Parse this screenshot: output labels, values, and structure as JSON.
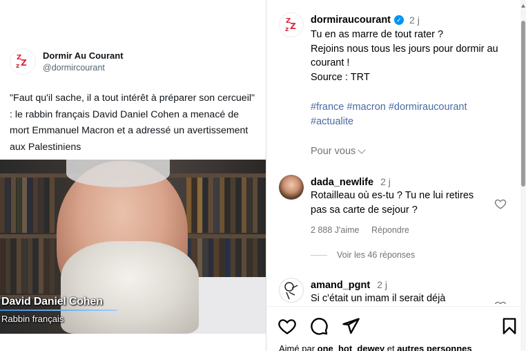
{
  "tweet": {
    "display_name": "Dormir Au Courant",
    "handle": "@dormircourant",
    "text": "\"Faut qu'il sache, il a tout intérêt à préparer son cercueil\" : le rabbin français David Daniel Cohen a menacé de mort Emmanuel Macron et a adressé un avertissement aux Palestiniens",
    "video_caption_name": "David Daniel Cohen",
    "video_caption_title": "Rabbin français",
    "avatar_glyph": "zzz-logo-icon"
  },
  "post": {
    "username": "dormiraucourant",
    "verified": true,
    "time": "2 j",
    "caption_lines": [
      "Tu en as marre de tout rater ?",
      "Rejoins nous tous les jours pour dormir au courant !",
      "Source : TRT"
    ],
    "hashtags": [
      "#france",
      "#macron",
      "#dormiraucourant",
      "#actualite"
    ],
    "for_you_label": "Pour vous"
  },
  "comments": [
    {
      "username": "dada_newlife",
      "time": "2 j",
      "text": "Rotailleau où es-tu ? Tu ne lui retires pas sa carte de sejour ?",
      "likes_label": "2 888 J'aime",
      "reply_label": "Répondre",
      "view_replies_label": "Voir les 46 réponses"
    },
    {
      "username": "amand_pgnt",
      "time": "2 j",
      "text": "Si c'était un imam il serait déjà"
    }
  ],
  "actions": {
    "like_icon": "heart-icon",
    "comment_icon": "comment-icon",
    "share_icon": "send-icon",
    "save_icon": "bookmark-icon"
  },
  "liked_by": {
    "prefix": "Aimé par ",
    "user": "one_hot_dewey",
    "middle": " et ",
    "others": "autres personnes"
  },
  "colors": {
    "hashtag": "#4a6aa3",
    "verified": "#0095f6",
    "logo_red": "#d9283a"
  }
}
